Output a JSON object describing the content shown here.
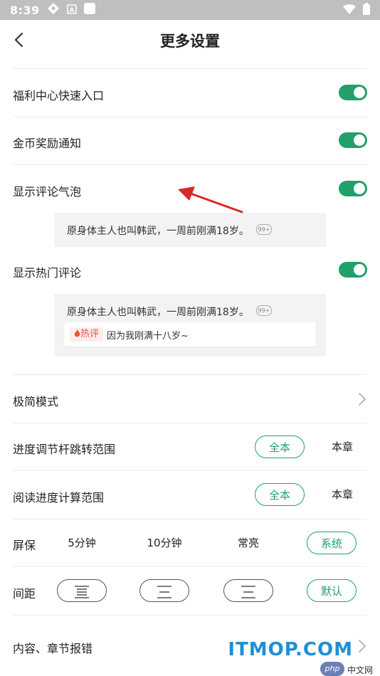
{
  "status_bar": {
    "time": "8:39",
    "icons": [
      "navigation-icon",
      "a-box-icon",
      "square-icon",
      "wifi-icon",
      "battery-icon"
    ]
  },
  "header": {
    "title": "更多设置"
  },
  "settings": {
    "welfare_entry": {
      "label": "福利中心快速入口",
      "on": true
    },
    "coin_notice": {
      "label": "金币奖励通知",
      "on": true
    },
    "comment_bubble": {
      "label": "显示评论气泡",
      "on": true,
      "preview_text": "原身体主人也叫韩武，一周前刚满18岁。",
      "badge": "99+"
    },
    "hot_comment": {
      "label": "显示热门评论",
      "on": true,
      "preview_text": "原身体主人也叫韩武，一周前刚满18岁。",
      "badge": "99+",
      "hot_tag": "热评",
      "hot_text": "因为我刚满十八岁~"
    },
    "simple_mode": {
      "label": "极简模式"
    },
    "progress_jump": {
      "label": "进度调节杆跳转范围",
      "options": [
        "全本",
        "本章"
      ],
      "selected": "全本"
    },
    "progress_calc": {
      "label": "阅读进度计算范围",
      "options": [
        "全本",
        "本章"
      ],
      "selected": "全本"
    },
    "screensaver": {
      "label": "屏保",
      "options": [
        "5分钟",
        "10分钟",
        "常亮",
        "系统"
      ],
      "selected": "系统"
    },
    "spacing": {
      "label": "间距",
      "selected_label": "默认"
    },
    "report": {
      "label": "内容、章节报错"
    }
  },
  "colors": {
    "accent": "#21a06a",
    "status_bar": "#bfbfbf",
    "annotation_arrow": "#d62828"
  },
  "watermark": {
    "text": "ITMOP.COM",
    "badge": "php",
    "cn": "中文网"
  }
}
